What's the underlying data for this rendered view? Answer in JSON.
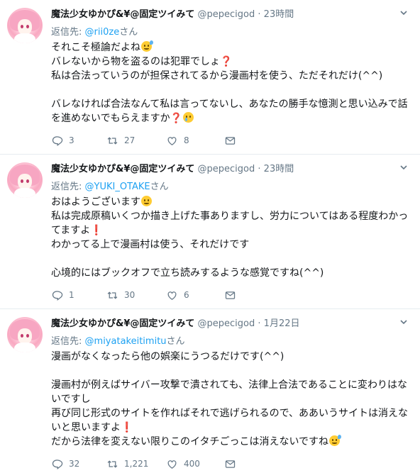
{
  "tweets": [
    {
      "name": "魔法少女ゆかぴ&¥@固定ツイみて",
      "handle": "@pepecigod",
      "dot": "·",
      "time": "23時間",
      "reply_prefix": "返信先:",
      "reply_mention": "@rii0ze",
      "reply_suffix": "さん",
      "lines": [
        "それこそ極論だよね",
        "バレないから物を盗るのは犯罪でしょ",
        "私は合法っていうのが担保されてるから漫画村を使う、ただそれだけ(^^)",
        "",
        "バレなければ合法なんて私は言ってないし、あなたの勝手な憶測と思い込みで話",
        "を進めないでもらえますか"
      ],
      "replies": "3",
      "retweets": "27",
      "likes": "8"
    },
    {
      "name": "魔法少女ゆかぴ&¥@固定ツイみて",
      "handle": "@pepecigod",
      "dot": "·",
      "time": "23時間",
      "reply_prefix": "返信先:",
      "reply_mention": "@YUKI_OTAKE",
      "reply_suffix": "さん",
      "lines": [
        "おはようございます",
        "私は完成原稿いくつか描き上げた事ありますし、労力についてはある程度わかっ",
        "てますよ",
        "わかってる上で漫画村は使う、それだけです",
        "",
        "心境的にはブックオフで立ち読みするような感覚ですね(^^)"
      ],
      "replies": "1",
      "retweets": "30",
      "likes": "6"
    },
    {
      "name": "魔法少女ゆかぴ&¥@固定ツイみて",
      "handle": "@pepecigod",
      "dot": "·",
      "time": "1月22日",
      "reply_prefix": "返信先:",
      "reply_mention": "@miyatakeitimitu",
      "reply_suffix": "さん",
      "lines": [
        "漫画がなくなったら他の娯楽にうつるだけです(^^)",
        "",
        "漫画村が例えばサイバー攻撃で潰されても、法律上合法であることに変わりはな",
        "いですし",
        "再び同じ形式のサイトを作ればそれで逃げられるので、ああいうサイトは消えな",
        "いと思いますよ",
        "だから法律を変えない限りこのイタチごっこは消えないですね"
      ],
      "replies": "32",
      "retweets": "1,221",
      "likes": "400"
    }
  ],
  "icons": {
    "reply": "reply-icon",
    "retweet": "retweet-icon",
    "like": "heart-icon",
    "dm": "envelope-icon",
    "more": "chevron-down-icon"
  },
  "colors": {
    "text": "#14171a",
    "muted": "#657786",
    "link": "#1da1f2",
    "divider": "#e6ecf0",
    "exclaim": "#d9264a"
  }
}
